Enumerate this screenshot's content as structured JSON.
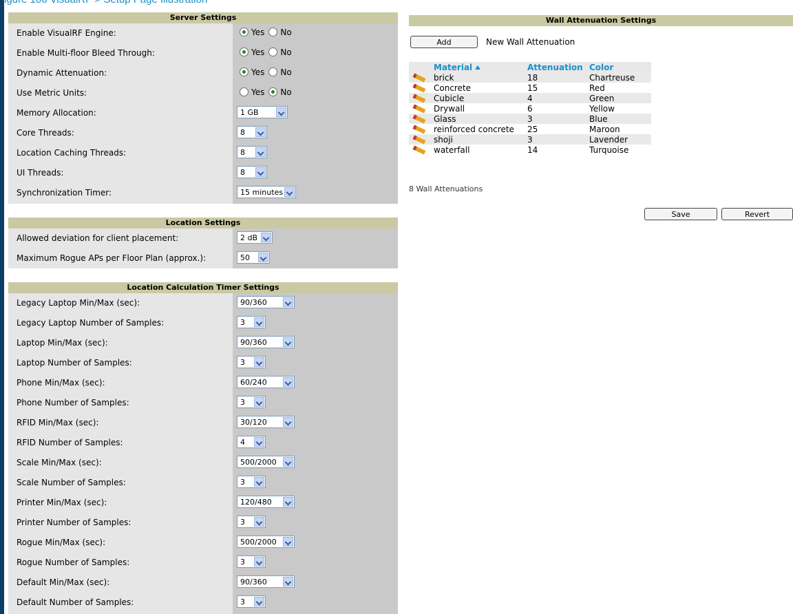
{
  "page": {
    "top_caption": "igure 106 VisualRF > Setup Page Illustration"
  },
  "server_settings": {
    "title": "Server Settings",
    "rows": [
      {
        "label": "Enable VisualRF Engine:",
        "type": "radio",
        "yes": "Yes",
        "no": "No",
        "value": "Yes"
      },
      {
        "label": "Enable Multi-floor Bleed Through:",
        "type": "radio",
        "yes": "Yes",
        "no": "No",
        "value": "Yes"
      },
      {
        "label": "Dynamic Attenuation:",
        "type": "radio",
        "yes": "Yes",
        "no": "No",
        "value": "Yes"
      },
      {
        "label": "Use Metric Units:",
        "type": "radio",
        "yes": "Yes",
        "no": "No",
        "value": "No"
      },
      {
        "label": "Memory Allocation:",
        "type": "select",
        "value": "1 GB"
      },
      {
        "label": "Core Threads:",
        "type": "select",
        "value": "8"
      },
      {
        "label": "Location Caching Threads:",
        "type": "select",
        "value": "8"
      },
      {
        "label": "UI Threads:",
        "type": "select",
        "value": "8"
      },
      {
        "label": "Synchronization Timer:",
        "type": "select",
        "value": "15 minutes"
      }
    ]
  },
  "location_settings": {
    "title": "Location Settings",
    "rows": [
      {
        "label": "Allowed deviation for client placement:",
        "value": "2 dB"
      },
      {
        "label": "Maximum Rogue APs per Floor Plan (approx.):",
        "value": "50"
      }
    ]
  },
  "timer_settings": {
    "title": "Location Calculation Timer Settings",
    "rows": [
      {
        "label": "Legacy Laptop Min/Max (sec):",
        "value": "90/360"
      },
      {
        "label": "Legacy Laptop Number of Samples:",
        "value": "3"
      },
      {
        "label": "Laptop Min/Max (sec):",
        "value": "90/360"
      },
      {
        "label": "Laptop Number of Samples:",
        "value": "3"
      },
      {
        "label": "Phone Min/Max (sec):",
        "value": "60/240"
      },
      {
        "label": "Phone Number of Samples:",
        "value": "3"
      },
      {
        "label": "RFID Min/Max (sec):",
        "value": "30/120"
      },
      {
        "label": "RFID Number of Samples:",
        "value": "4"
      },
      {
        "label": "Scale Min/Max (sec):",
        "value": "500/2000"
      },
      {
        "label": "Scale Number of Samples:",
        "value": "3"
      },
      {
        "label": "Printer Min/Max (sec):",
        "value": "120/480"
      },
      {
        "label": "Printer Number of Samples:",
        "value": "3"
      },
      {
        "label": "Rogue Min/Max (sec):",
        "value": "500/2000"
      },
      {
        "label": "Rogue Number of Samples:",
        "value": "3"
      },
      {
        "label": "Default Min/Max (sec):",
        "value": "90/360"
      },
      {
        "label": "Default Number of Samples:",
        "value": "3"
      }
    ]
  },
  "wall": {
    "title": "Wall Attenuation Settings",
    "add_label": "Add",
    "new_label": "New Wall Attenuation",
    "columns": [
      "Material",
      "Attenuation",
      "Color"
    ],
    "rows": [
      [
        "brick",
        "18",
        "Chartreuse"
      ],
      [
        "Concrete",
        "15",
        "Red"
      ],
      [
        "Cubicle",
        "4",
        "Green"
      ],
      [
        "Drywall",
        "6",
        "Yellow"
      ],
      [
        "Glass",
        "3",
        "Blue"
      ],
      [
        "reinforced concrete",
        "25",
        "Maroon"
      ],
      [
        "shoji",
        "3",
        "Lavender"
      ],
      [
        "waterfall",
        "14",
        "Turquoise"
      ]
    ],
    "count_label": "8 Wall Attenuations",
    "save_label": "Save",
    "revert_label": "Revert"
  },
  "colors": {
    "header_bg": "#c9c9a3",
    "link": "#1a8fc8",
    "frame": "#0d3f66"
  },
  "icons": {
    "edit": "pencil-icon",
    "sort": "sort-ascending-icon",
    "dropdown": "chevron-down-icon"
  }
}
